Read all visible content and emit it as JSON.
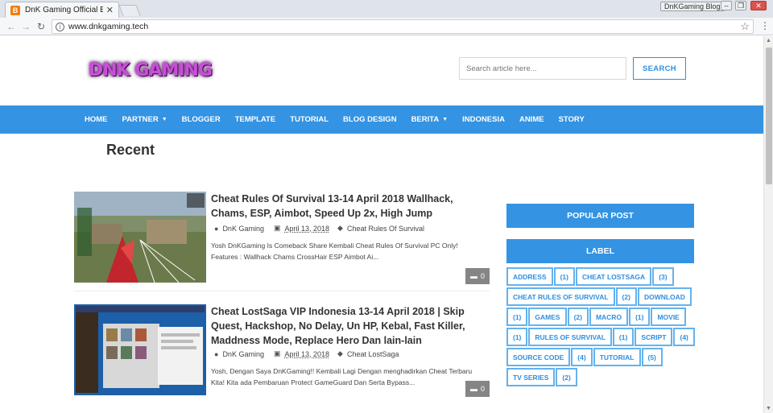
{
  "browser": {
    "tab_title": "DnK Gaming Official Blogger",
    "tab_close": "✕",
    "url": "www.dnkgaming.tech",
    "profile": "DnKGaming Blog",
    "favicon": "B"
  },
  "header": {
    "logo": "DNK GAMING",
    "search_placeholder": "Search article here...",
    "search_button": "SEARCH"
  },
  "nav": [
    {
      "label": "HOME"
    },
    {
      "label": "PARTNER",
      "dropdown": true
    },
    {
      "label": "BLOGGER"
    },
    {
      "label": "TEMPLATE"
    },
    {
      "label": "TUTORIAL"
    },
    {
      "label": "BLOG DESIGN"
    },
    {
      "label": "BERITA",
      "dropdown": true
    },
    {
      "label": "INDONESIA"
    },
    {
      "label": "ANIME"
    },
    {
      "label": "STORY"
    }
  ],
  "main": {
    "section_title": "Recent",
    "posts": [
      {
        "title": "Cheat Rules Of Survival 13-14 April 2018 Wallhack, Chams, ESP, Aimbot, Speed Up 2x, High Jump",
        "author": "DnK Gaming",
        "date": "April 13, 2018",
        "label": "Cheat Rules Of Survival",
        "excerpt": "Yosh DnKGaming Is Comeback Share Kembali Cheat Rules Of Survival PC Only! Features :  Wallhack Chams CrossHair ESP Aimbot Ai...",
        "comments": "0"
      },
      {
        "title": "Cheat LostSaga VIP Indonesia 13-14 April 2018 | Skip Quest, Hackshop, No Delay, Un HP, Kebal, Fast Killer, Maddness Mode, Replace Hero Dan lain-lain",
        "author": "DnK Gaming",
        "date": "April 13, 2018",
        "label": "Cheat LostSaga",
        "excerpt": "Yosh, Dengan Saya DnKGaming!! Kembali Lagi Dengan menghadirkan Cheat Terbaru Kita! Kita ada Pembaruan Protect GameGuard Dan Serta Bypass...",
        "comments": "0"
      }
    ]
  },
  "sidebar": {
    "popular_title": "POPULAR POST",
    "label_title": "LABEL",
    "labels": [
      {
        "name": "ADDRESS",
        "count": "(1)"
      },
      {
        "name": "CHEAT LOSTSAGA",
        "count": "(3)"
      },
      {
        "name": "CHEAT RULES OF SURVIVAL",
        "count": "(2)"
      },
      {
        "name": "DOWNLOAD",
        "count": "(1)"
      },
      {
        "name": "GAMES",
        "count": "(2)"
      },
      {
        "name": "MACRO",
        "count": "(1)"
      },
      {
        "name": "MOVIE",
        "count": "(1)"
      },
      {
        "name": "RULES OF SURVIVAL",
        "count": "(1)"
      },
      {
        "name": "SCRIPT",
        "count": "(4)"
      },
      {
        "name": "SOURCE CODE",
        "count": "(4)"
      },
      {
        "name": "TUTORIAL",
        "count": "(5)"
      },
      {
        "name": "TV SERIES",
        "count": "(2)"
      }
    ]
  },
  "colors": {
    "accent": "#3493e2",
    "label_border": "#64b2ee",
    "comment_badge": "#858585"
  }
}
